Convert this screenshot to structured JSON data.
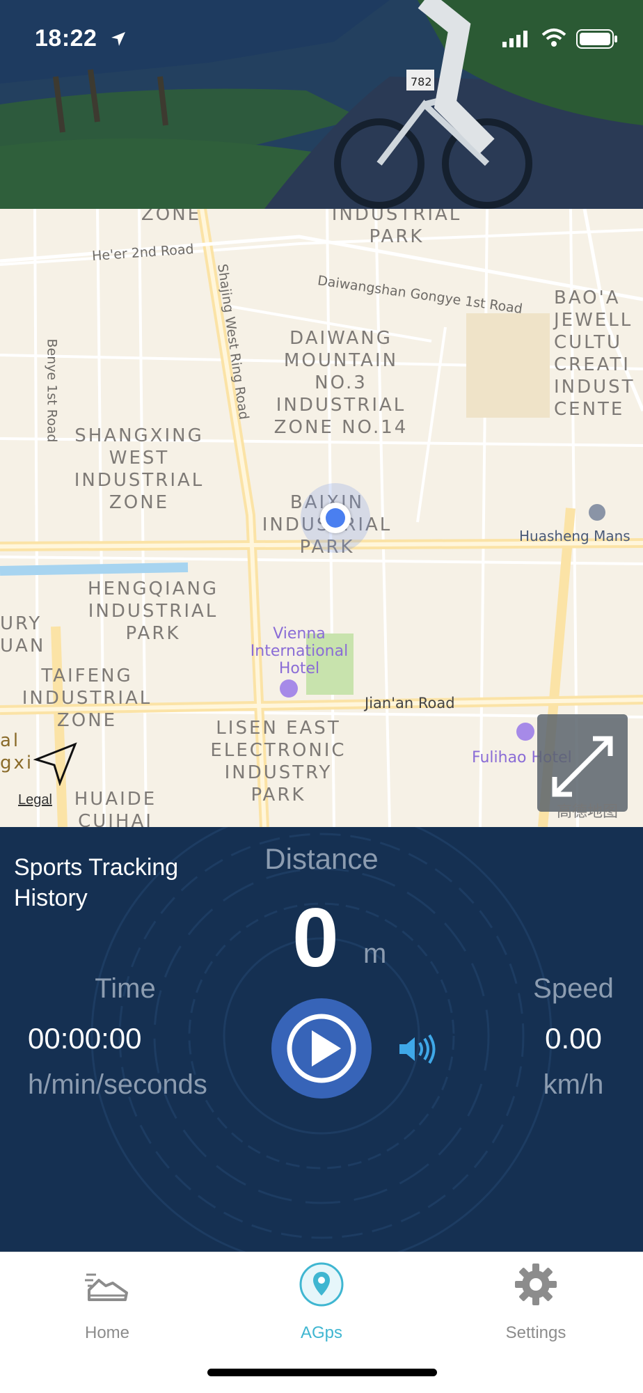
{
  "status_bar": {
    "time": "18:22"
  },
  "hero": {
    "bib_number": "782"
  },
  "map": {
    "areas": [
      {
        "text": "ZONE"
      },
      {
        "text": "INDUSTRIAL\nPARK"
      },
      {
        "text": "DAIWANG\nMOUNTAIN\nNO.3\nINDUSTRIAL\nZONE NO.14"
      },
      {
        "text": "SHANGXING\nWEST\nINDUSTRIAL\nZONE"
      },
      {
        "text": "BAIXIN\nINDUSTRIAL\nPARK"
      },
      {
        "text": "HENGQIANG\nINDUSTRIAL\nPARK"
      },
      {
        "text": "URY\nUAN"
      },
      {
        "text": "TAIFENG\nINDUSTRIAL\nZONE"
      },
      {
        "text": "LISEN EAST\nELECTRONIC\nINDUSTRY\nPARK"
      },
      {
        "text": "HUAIDE\nCUIHAI"
      },
      {
        "text": "BAO'A\nJEWELL\nCULTU\nCREATI\nINDUST\nCENTE"
      },
      {
        "text": "al\ngxi"
      }
    ],
    "roads": {
      "heer": "He'er 2nd Road",
      "daiwangshan": "Daiwangshan Gongye 1st Road",
      "shajing": "Shajing West Ring Road",
      "benye": "Benye 1st Road",
      "jianan": "Jian'an Road"
    },
    "pois": {
      "vienna": "Vienna\nInternational\nHotel",
      "fulihao": "Fulihao Hotel",
      "huasheng": "Huasheng Mans"
    },
    "legal": "Legal",
    "provider": "高德地图"
  },
  "dashboard": {
    "history_label": "Sports Tracking History",
    "distance_label": "Distance",
    "distance_value": "0",
    "distance_unit": "m",
    "time_label": "Time",
    "time_value": "00:00:00",
    "time_unit": "h/min/seconds",
    "speed_label": "Speed",
    "speed_value": "0.00",
    "speed_unit": "km/h"
  },
  "tabs": [
    {
      "label": "Home",
      "icon": "running-shoe-icon"
    },
    {
      "label": "AGps",
      "icon": "location-pin-icon"
    },
    {
      "label": "Settings",
      "icon": "gear-icon"
    }
  ],
  "colors": {
    "dashboard_bg": "#153052",
    "play_button": "#3764b8",
    "active_tab": "#3fb6d1",
    "location_dot": "#4a7ff0"
  }
}
